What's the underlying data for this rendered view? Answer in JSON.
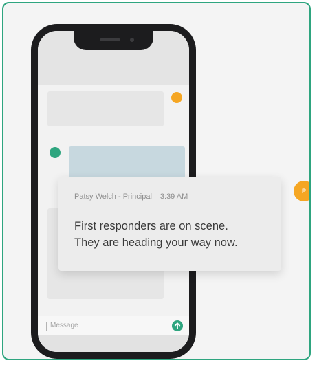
{
  "notification": {
    "sender": "Patsy Welch - Principal",
    "time": "3:39 AM",
    "body_line1": "First responders are on scene.",
    "body_line2": "They are heading your way now.",
    "avatar_initial": "P"
  },
  "composer": {
    "placeholder": "Message",
    "send_icon": "arrow-up-icon"
  },
  "colors": {
    "accent_green": "#2ea57f",
    "accent_orange": "#f5a623",
    "frame_border": "#2ea57f"
  }
}
